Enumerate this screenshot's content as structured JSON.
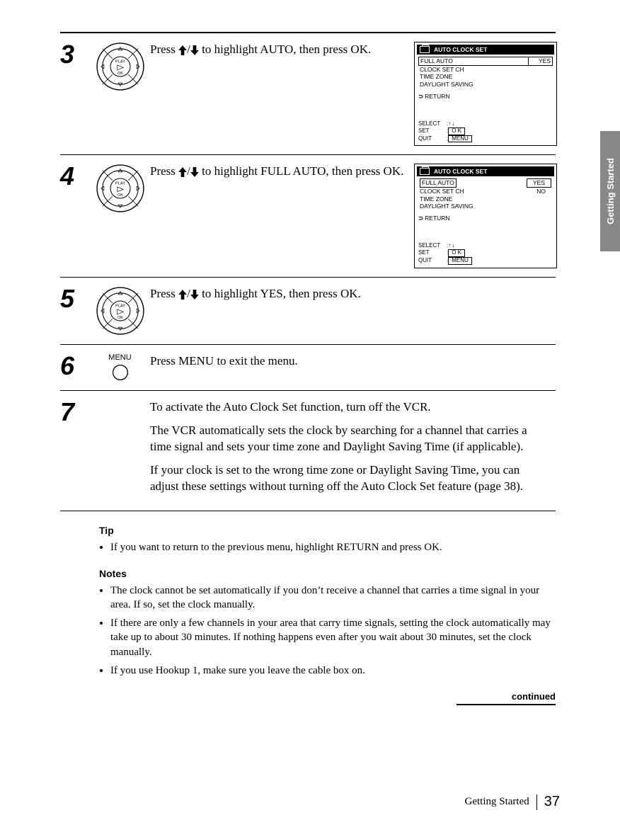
{
  "side_tab": "Getting Started",
  "steps": {
    "s3": {
      "num": "3",
      "text_a": "Press ",
      "text_b": " to highlight AUTO, then press OK."
    },
    "s4": {
      "num": "4",
      "text_a": "Press ",
      "text_b": " to highlight FULL AUTO, then press OK."
    },
    "s5": {
      "num": "5",
      "text_a": "Press ",
      "text_b": " to highlight YES, then press OK."
    },
    "s6": {
      "num": "6",
      "menu_label": "MENU",
      "text": "Press MENU to exit the menu."
    },
    "s7": {
      "num": "7",
      "p1": "To activate the Auto Clock Set function, turn off the VCR.",
      "p2": "The VCR automatically sets the clock by searching for a channel that carries a time signal and sets your time zone and Daylight Saving Time (if applicable).",
      "p3": "If your clock is set to the wrong time zone or Daylight Saving Time, you can adjust these settings without turning off the Auto Clock Set feature (page 38)."
    }
  },
  "dpad": {
    "play": "PLAY",
    "ok": "OK"
  },
  "osd": {
    "title": "AUTO CLOCK  SET",
    "full_auto": "FULL  AUTO",
    "clock_set_ch": "CLOCK  SET  CH",
    "time_zone": "TIME  ZONE",
    "daylight": "DAYLIGHT  SAVING",
    "return": "RETURN",
    "yes": "YES",
    "no": "NO",
    "footer": {
      "select": "SELECT",
      "set": "SET",
      "quit": "QUIT",
      "ok": "O K",
      "menu": "MENU"
    }
  },
  "tip": {
    "heading": "Tip",
    "item": "If you want to return to the previous menu, highlight RETURN and press OK."
  },
  "notes": {
    "heading": "Notes",
    "n1": "The clock cannot be set automatically if you don’t receive a channel that carries a time signal in your area.  If so, set the clock manually.",
    "n2": "If there are only a few channels in your area that carry time signals, setting the clock automatically may take up to about 30 minutes.  If nothing happens even after you wait about 30 minutes, set the clock manually.",
    "n3": "If you use Hookup 1, make sure you leave the cable box on."
  },
  "continued": "continued",
  "footer": {
    "section": "Getting Started",
    "page": "37"
  }
}
